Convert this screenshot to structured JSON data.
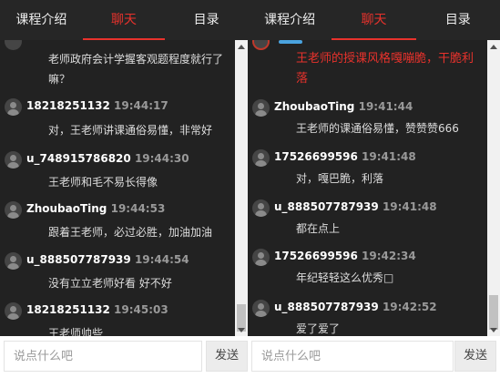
{
  "left_panel": {
    "tabs": [
      {
        "label": "课程介绍"
      },
      {
        "label": "聊天"
      },
      {
        "label": "目录"
      }
    ],
    "partial_message": "老师政府会计学握客观题程度就行了嘛？",
    "messages": [
      {
        "user": "18218251132",
        "time": "19:44:17",
        "text": "对，王老师讲课通俗易懂，非常好"
      },
      {
        "user": "u_748915786820",
        "time": "19:44:30",
        "text": "王老师和毛不易长得像"
      },
      {
        "user": "ZhoubaoTing",
        "time": "19:44:53",
        "text": "跟着王老师，必过必胜，加油加油"
      },
      {
        "user": "u_888507787939",
        "time": "19:44:54",
        "text": "没有立立老师好看 好不好"
      },
      {
        "user": "18218251132",
        "time": "19:45:03",
        "text": "王老师帅些"
      }
    ],
    "input_placeholder": "说点什么吧",
    "send_label": "发送"
  },
  "right_panel": {
    "tabs": [
      {
        "label": "课程介绍"
      },
      {
        "label": "聊天"
      },
      {
        "label": "目录"
      }
    ],
    "partial_message": "王老师的授课风格嘎嘣脆，干脆利落",
    "messages": [
      {
        "user": "ZhoubaoTing",
        "time": "19:41:44",
        "text": "王老师的课通俗易懂，赞赞赞666"
      },
      {
        "user": "17526699596",
        "time": "19:41:48",
        "text": "对，嘎巴脆，利落"
      },
      {
        "user": "u_888507787939",
        "time": "19:41:48",
        "text": "都在点上"
      },
      {
        "user": "17526699596",
        "time": "19:42:34",
        "text": "年纪轻轻这么优秀□"
      },
      {
        "user": "u_888507787939",
        "time": "19:42:52",
        "text": "爱了爱了"
      }
    ],
    "input_placeholder": "说点什么吧",
    "send_label": "发送"
  },
  "colors": {
    "accent": "#e8322c",
    "panel_bg": "#222222",
    "username": "#ffffff",
    "timestamp": "#999999"
  }
}
